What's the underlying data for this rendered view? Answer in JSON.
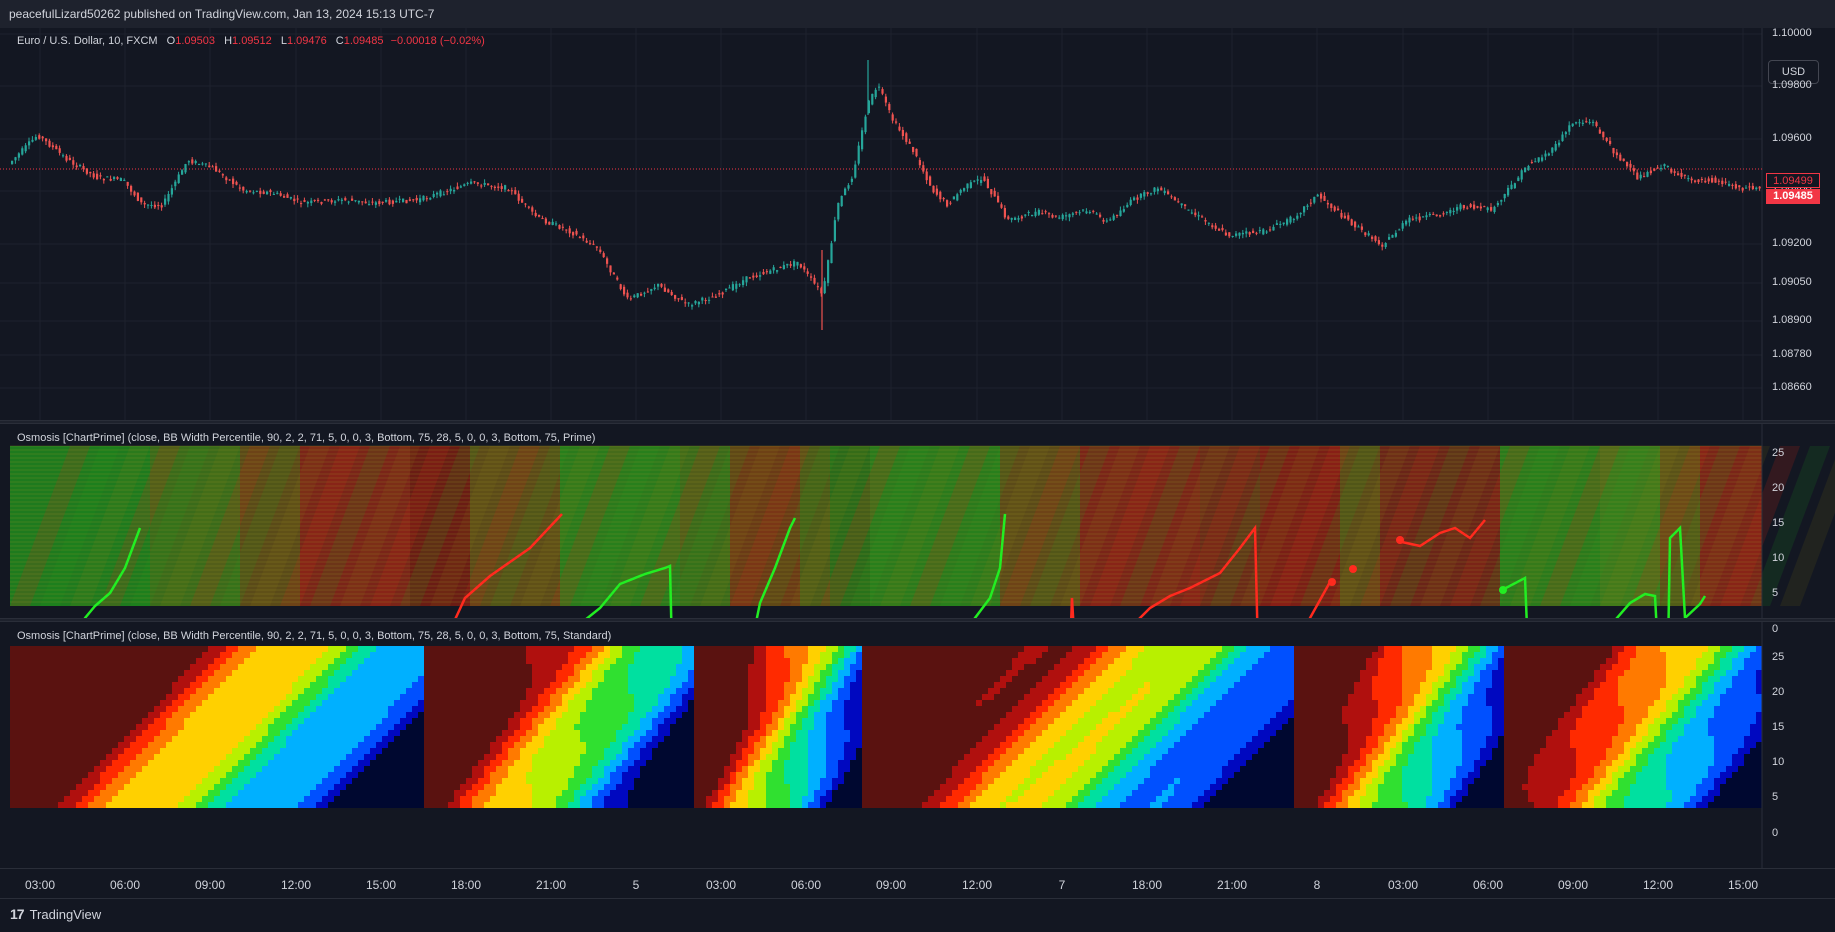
{
  "header": {
    "published": "peacefulLizard50262 published on TradingView.com, Jan 13, 2024 15:13 UTC-7"
  },
  "main_pane": {
    "symbol": "Euro / U.S. Dollar, 10, FXCM",
    "open_key": "O",
    "open": "1.09503",
    "high_key": "H",
    "high": "1.09512",
    "low_key": "L",
    "low": "1.09476",
    "close_key": "C",
    "close": "1.09485",
    "change": "−0.00018 (−0.02%)",
    "currency_button": "USD",
    "price_axis": [
      "1.10000",
      "1.09800",
      "1.09600",
      "1.09400",
      "1.09200",
      "1.09050",
      "1.08900",
      "1.08780",
      "1.08660"
    ],
    "price_tags": {
      "prev": "1.09499",
      "last": "1.09485"
    },
    "colors": {
      "up": "#26a69a",
      "down": "#ef5350"
    }
  },
  "indicator_1": {
    "title": "Osmosis [ChartPrime] (close, BB Width Percentile, 90, 2, 2, 71, 5, 0, 0, 3, Bottom, 75, 28, 5, 0, 0, 3, Bottom, 75, Prime)",
    "axis": [
      "25",
      "20",
      "15",
      "10",
      "5",
      "0"
    ]
  },
  "indicator_2": {
    "title": "Osmosis [ChartPrime] (close, BB Width Percentile, 90, 2, 2, 71, 5, 0, 0, 3, Bottom, 75, 28, 5, 0, 0, 3, Bottom, 75, Standard)",
    "axis": [
      "25",
      "20",
      "15",
      "10",
      "5",
      "0"
    ]
  },
  "time_axis": [
    "03:00",
    "06:00",
    "09:00",
    "12:00",
    "15:00",
    "18:00",
    "21:00",
    "5",
    "03:00",
    "06:00",
    "09:00",
    "12:00",
    "7",
    "18:00",
    "21:00",
    "8",
    "03:00",
    "06:00",
    "09:00",
    "12:00",
    "15:00"
  ],
  "footer": {
    "logo_text": "TradingView",
    "logo_mark": "17"
  }
}
